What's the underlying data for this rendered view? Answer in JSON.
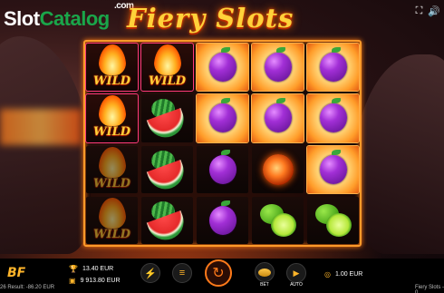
{
  "brand": {
    "slot": "Slot",
    "catalog": "Catalog",
    "com": ".com"
  },
  "game": {
    "title": "Fiery Slots"
  },
  "top_icons": [
    "fullscreen-icon",
    "sound-icon"
  ],
  "reels": [
    [
      "wild",
      "wild",
      "wild-dim",
      "wild-dim"
    ],
    [
      "wild",
      "watermelon",
      "watermelon",
      "watermelon"
    ],
    [
      "plum-hl",
      "plum-hl",
      "plum",
      "plum"
    ],
    [
      "plum-hl",
      "plum-hl",
      "fireball",
      "lime"
    ],
    [
      "plum-hl",
      "plum-hl",
      "plum-hl",
      "lime"
    ]
  ],
  "wild_label": "WILD",
  "stats": {
    "win_value": "13.40 EUR",
    "balance_value": "9 913.80 EUR",
    "bet_value": "1.00 EUR"
  },
  "buttons": {
    "bet_label": "BET",
    "auto_label": "AUTO"
  },
  "footer": {
    "left": "26 Result: -86.20 EUR",
    "right": "Fiery Slots - 0"
  },
  "colors": {
    "accent": "#ffb52a",
    "frame": "#ff9a2a",
    "brand_green": "#1aa64a"
  }
}
